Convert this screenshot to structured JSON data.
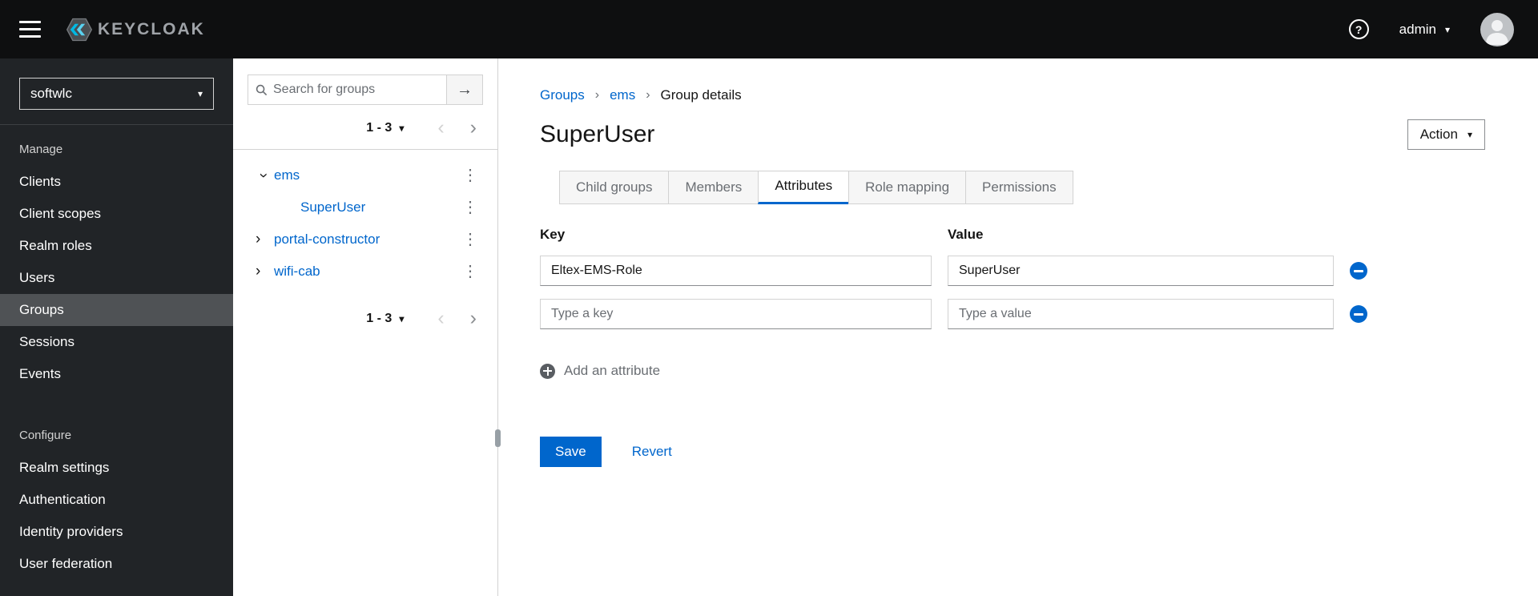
{
  "colors": {
    "accent": "#0066cc",
    "header_bg": "#0e0f10",
    "sidebar_bg": "#212427",
    "sidebar_selected_bg": "#4f5255",
    "link": "#0066cc",
    "muted_text": "#6a6e73",
    "border": "#d2d2d2",
    "logo_cyan": "#00b9e4"
  },
  "icons": {
    "caret_down": "▾",
    "kebab": "⋮",
    "angle_right": "›",
    "chevron_left": "‹",
    "chevron_right": "›",
    "arrow_right": "→",
    "breadcrumb_sep": "›",
    "help": "?"
  },
  "header": {
    "brand": "KEYCLOAK",
    "username": "admin"
  },
  "sidebar": {
    "realm": "softwlc",
    "manage_label": "Manage",
    "manage_items": [
      "Clients",
      "Client scopes",
      "Realm roles",
      "Users",
      "Groups",
      "Sessions",
      "Events"
    ],
    "configure_label": "Configure",
    "configure_items": [
      "Realm settings",
      "Authentication",
      "Identity providers",
      "User federation"
    ],
    "selected_item": "Groups"
  },
  "groups_panel": {
    "search_placeholder": "Search for groups",
    "pagination_label": "1 - 3",
    "tree": [
      {
        "label": "ems",
        "state": "expanded"
      },
      {
        "label": "SuperUser",
        "state": "child"
      },
      {
        "label": "portal-constructor",
        "state": "collapsed"
      },
      {
        "label": "wifi-cab",
        "state": "collapsed"
      }
    ]
  },
  "main": {
    "breadcrumb": [
      "Groups",
      "ems",
      "Group details"
    ],
    "title": "SuperUser",
    "action_label": "Action",
    "tabs": [
      "Child groups",
      "Members",
      "Attributes",
      "Role mapping",
      "Permissions"
    ],
    "active_tab": "Attributes",
    "attributes": {
      "key_header": "Key",
      "value_header": "Value",
      "rows": [
        {
          "key": "Eltex-EMS-Role",
          "value": "SuperUser"
        },
        {
          "key_placeholder": "Type a key",
          "value_placeholder": "Type a value"
        }
      ],
      "add_label": "Add an attribute"
    },
    "save_label": "Save",
    "revert_label": "Revert"
  }
}
